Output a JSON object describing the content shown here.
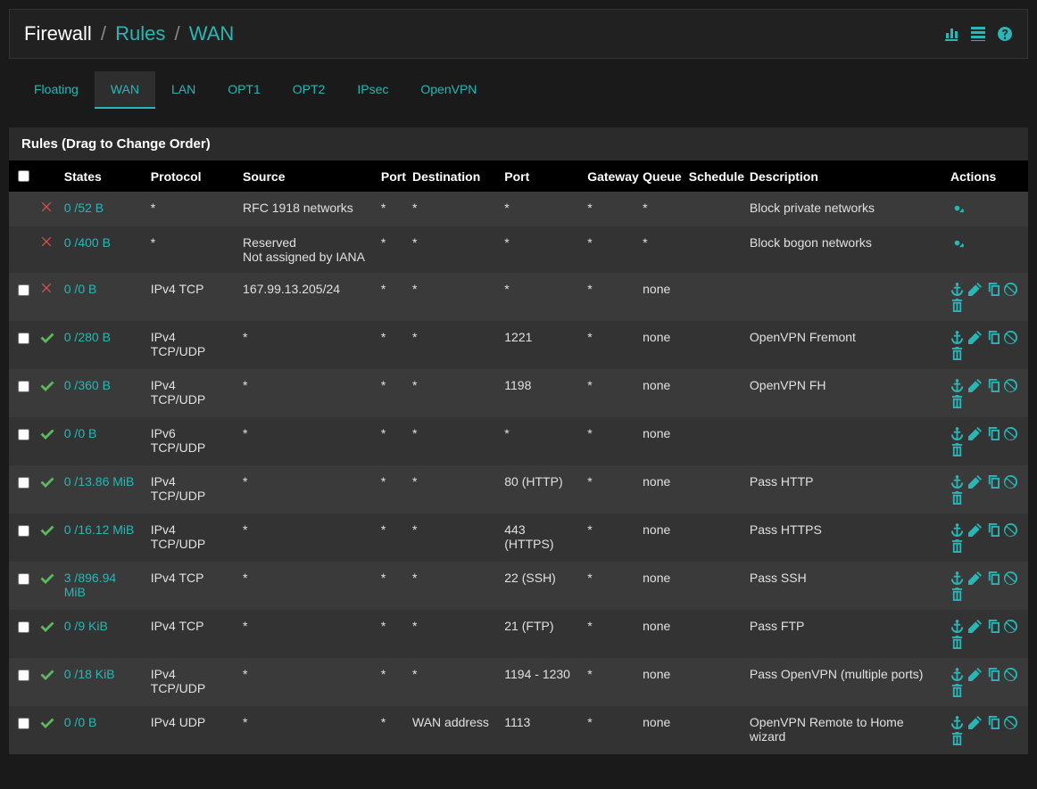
{
  "breadcrumb": {
    "section": "Firewall",
    "sub": "Rules",
    "leaf": "WAN"
  },
  "header_icons": [
    "bar-chart-icon",
    "list-icon",
    "help-icon"
  ],
  "tabs": [
    {
      "label": "Floating",
      "active": false
    },
    {
      "label": "WAN",
      "active": true
    },
    {
      "label": "LAN",
      "active": false
    },
    {
      "label": "OPT1",
      "active": false
    },
    {
      "label": "OPT2",
      "active": false
    },
    {
      "label": "IPsec",
      "active": false
    },
    {
      "label": "OpenVPN",
      "active": false
    }
  ],
  "panel_title": "Rules (Drag to Change Order)",
  "columns": {
    "states": "States",
    "protocol": "Protocol",
    "source": "Source",
    "sport": "Port",
    "destination": "Destination",
    "dport": "Port",
    "gateway": "Gateway",
    "queue": "Queue",
    "schedule": "Schedule",
    "description": "Description",
    "actions": "Actions"
  },
  "rules": [
    {
      "checkbox": false,
      "status": "block",
      "states": "0 /52 B",
      "protocol": "*",
      "source": "RFC 1918 networks",
      "sport": "*",
      "destination": "*",
      "dport": "*",
      "gateway": "*",
      "queue": "*",
      "schedule": "",
      "description": "Block private networks",
      "actions": [
        "settings"
      ]
    },
    {
      "checkbox": false,
      "status": "block",
      "states": "0 /400 B",
      "protocol": "*",
      "source": "Reserved\nNot assigned by IANA",
      "sport": "*",
      "destination": "*",
      "dport": "*",
      "gateway": "*",
      "queue": "*",
      "schedule": "",
      "description": "Block bogon networks",
      "actions": [
        "settings"
      ]
    },
    {
      "checkbox": true,
      "status": "block",
      "states": "0 /0 B",
      "protocol": "IPv4 TCP",
      "source": "167.99.13.205/24",
      "sport": "*",
      "destination": "*",
      "dport": "*",
      "gateway": "*",
      "queue": "none",
      "schedule": "",
      "description": "",
      "actions": [
        "anchor",
        "edit",
        "copy",
        "disable",
        "delete"
      ]
    },
    {
      "checkbox": true,
      "status": "pass",
      "states": "0 /280 B",
      "protocol": "IPv4 TCP/UDP",
      "source": "*",
      "sport": "*",
      "destination": "*",
      "dport": "1221",
      "gateway": "*",
      "queue": "none",
      "schedule": "",
      "description": "OpenVPN Fremont",
      "actions": [
        "anchor",
        "edit",
        "copy",
        "disable",
        "delete"
      ]
    },
    {
      "checkbox": true,
      "status": "pass",
      "states": "0 /360 B",
      "protocol": "IPv4 TCP/UDP",
      "source": "*",
      "sport": "*",
      "destination": "*",
      "dport": "1198",
      "gateway": "*",
      "queue": "none",
      "schedule": "",
      "description": "OpenVPN FH",
      "actions": [
        "anchor",
        "edit",
        "copy",
        "disable",
        "delete"
      ]
    },
    {
      "checkbox": true,
      "status": "pass",
      "states": "0 /0 B",
      "protocol": "IPv6 TCP/UDP",
      "source": "*",
      "sport": "*",
      "destination": "*",
      "dport": "*",
      "gateway": "*",
      "queue": "none",
      "schedule": "",
      "description": "",
      "actions": [
        "anchor",
        "edit",
        "copy",
        "disable",
        "delete"
      ]
    },
    {
      "checkbox": true,
      "status": "pass",
      "states": "0 /13.86 MiB",
      "protocol": "IPv4 TCP/UDP",
      "source": "*",
      "sport": "*",
      "destination": "*",
      "dport": "80 (HTTP)",
      "gateway": "*",
      "queue": "none",
      "schedule": "",
      "description": "Pass HTTP",
      "actions": [
        "anchor",
        "edit",
        "copy",
        "disable",
        "delete"
      ]
    },
    {
      "checkbox": true,
      "status": "pass",
      "states": "0 /16.12 MiB",
      "protocol": "IPv4 TCP/UDP",
      "source": "*",
      "sport": "*",
      "destination": "*",
      "dport": "443 (HTTPS)",
      "gateway": "*",
      "queue": "none",
      "schedule": "",
      "description": "Pass HTTPS",
      "actions": [
        "anchor",
        "edit",
        "copy",
        "disable",
        "delete"
      ]
    },
    {
      "checkbox": true,
      "status": "pass",
      "states": "3 /896.94 MiB",
      "protocol": "IPv4 TCP",
      "source": "*",
      "sport": "*",
      "destination": "*",
      "dport": "22 (SSH)",
      "gateway": "*",
      "queue": "none",
      "schedule": "",
      "description": "Pass SSH",
      "actions": [
        "anchor",
        "edit",
        "copy",
        "disable",
        "delete"
      ]
    },
    {
      "checkbox": true,
      "status": "pass",
      "states": "0 /9 KiB",
      "protocol": "IPv4 TCP",
      "source": "*",
      "sport": "*",
      "destination": "*",
      "dport": "21 (FTP)",
      "gateway": "*",
      "queue": "none",
      "schedule": "",
      "description": "Pass FTP",
      "actions": [
        "anchor",
        "edit",
        "copy",
        "disable",
        "delete"
      ]
    },
    {
      "checkbox": true,
      "status": "pass",
      "states": "0 /18 KiB",
      "protocol": "IPv4 TCP/UDP",
      "source": "*",
      "sport": "*",
      "destination": "*",
      "dport": "1194 - 1230",
      "gateway": "*",
      "queue": "none",
      "schedule": "",
      "description": "Pass OpenVPN (multiple ports)",
      "actions": [
        "anchor",
        "edit",
        "copy",
        "disable",
        "delete"
      ]
    },
    {
      "checkbox": true,
      "status": "pass",
      "states": "0 /0 B",
      "protocol": "IPv4 UDP",
      "source": "*",
      "sport": "*",
      "destination": "WAN address",
      "dport": "1113",
      "gateway": "*",
      "queue": "none",
      "schedule": "",
      "description": "OpenVPN Remote to Home wizard",
      "actions": [
        "anchor",
        "edit",
        "copy",
        "disable",
        "delete"
      ]
    }
  ]
}
